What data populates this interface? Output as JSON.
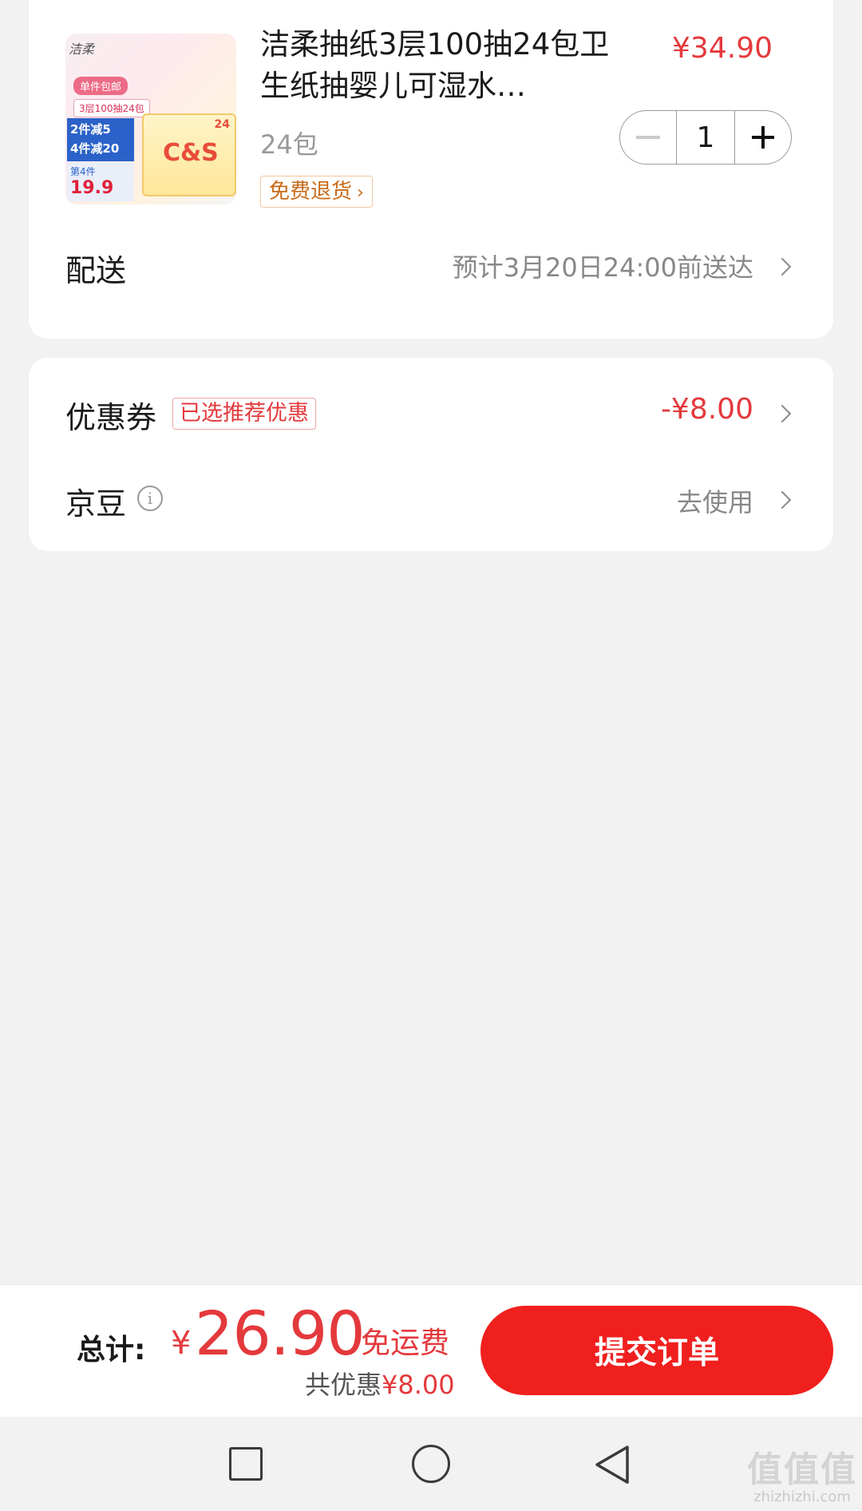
{
  "product": {
    "title": "洁柔抽纸3层100抽24包卫生纸抽婴儿可湿水…",
    "price": "¥34.90",
    "spec": "24包",
    "return_tag": "免费退货",
    "quantity": "1",
    "thumbnail": {
      "brand": "洁柔",
      "tag_single": "单件包邮",
      "tag_spec": "3层100抽24包",
      "promo_line1": "2件减5",
      "promo_line2": "4件减20",
      "promo_small": "第4件",
      "promo_price": "19.9",
      "box_logo": "C&S",
      "box_count": "24"
    }
  },
  "delivery": {
    "label": "配送",
    "value": "预计3月20日24:00前送达"
  },
  "coupon": {
    "label": "优惠券",
    "badge": "已选推荐优惠",
    "value": "-¥8.00"
  },
  "jingdou": {
    "label": "京豆",
    "info_glyph": "i",
    "value": "去使用"
  },
  "footer": {
    "total_label": "总计:",
    "currency": "¥",
    "amount": "26.90",
    "shipping": "免运费",
    "saved_prefix": "共优惠",
    "saved_value": "¥8.00",
    "submit_label": "提交订单"
  },
  "nav": {
    "icons": [
      "recent-apps-icon",
      "home-icon",
      "back-icon"
    ]
  },
  "watermark": {
    "mark": "值值值",
    "url": "zhizhizhi.com"
  },
  "colors": {
    "accent": "#e4393c",
    "submit_bg": "#f0201e",
    "page_bg": "#f2f2f2"
  }
}
